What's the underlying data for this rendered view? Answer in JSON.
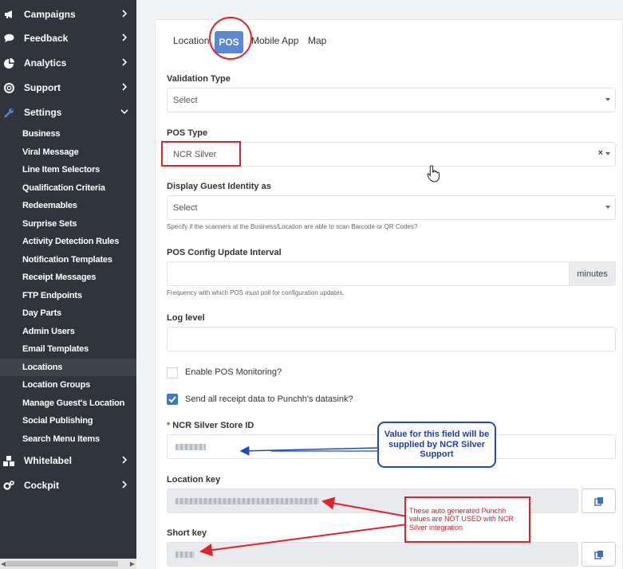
{
  "sidebar": {
    "top_items": [
      {
        "label": "Campaigns",
        "icon": "megaphone-icon"
      },
      {
        "label": "Feedback",
        "icon": "comment-icon"
      },
      {
        "label": "Analytics",
        "icon": "pie-chart-icon"
      },
      {
        "label": "Support",
        "icon": "life-ring-icon"
      },
      {
        "label": "Settings",
        "icon": "wrench-icon"
      }
    ],
    "settings_items": [
      "Business",
      "Viral Message",
      "Line Item Selectors",
      "Qualification Criteria",
      "Redeemables",
      "Surprise Sets",
      "Activity Detection Rules",
      "Notification Templates",
      "Receipt Messages",
      "FTP Endpoints",
      "Day Parts",
      "Admin Users",
      "Email Templates",
      "Locations",
      "Location Groups",
      "Manage Guest's Location",
      "Social Publishing",
      "Search Menu Items"
    ],
    "active_item": "Locations",
    "bottom_items": [
      {
        "label": "Whitelabel",
        "icon": "cubes-icon"
      },
      {
        "label": "Cockpit",
        "icon": "cogs-icon"
      }
    ]
  },
  "tabs": {
    "location": "Location",
    "pos": "POS",
    "mobile_app": "Mobile App",
    "map": "Map"
  },
  "form": {
    "validation_type": {
      "label": "Validation Type",
      "value": "Select"
    },
    "pos_type": {
      "label": "POS Type",
      "value": "NCR Silver",
      "clear": "×"
    },
    "display_guest_identity": {
      "label": "Display Guest Identity as",
      "value": "Select",
      "help": "Specify if the scanners at the Business/Location are able to scan Barcode or QR Codes?"
    },
    "pos_config_interval": {
      "label": "POS Config Update Interval",
      "addon": "minutes",
      "help": "Frequency with which POS must poll for configuration updates."
    },
    "log_level": {
      "label": "Log level"
    },
    "enable_pos_monitoring": {
      "label": "Enable POS Monitoring?",
      "checked": false
    },
    "send_receipt_data": {
      "label": "Send all receipt data to Punchh's datasink?",
      "checked": true
    },
    "ncr_store_id": {
      "required_mark": "*",
      "label": "NCR Silver Store ID"
    },
    "location_key": {
      "label": "Location key"
    },
    "short_key": {
      "label": "Short key"
    }
  },
  "annotations": {
    "blue_callout": "Value for this field will be supplied by NCR Silver Support",
    "red_callout": "These auto generated Punchh values are NOT USED with NCR Silver integration"
  },
  "colors": {
    "sidebar_bg": "#2f353a",
    "accent": "#5b87d5",
    "annotation_red": "#e0232a",
    "annotation_blue": "#1f48c8"
  }
}
